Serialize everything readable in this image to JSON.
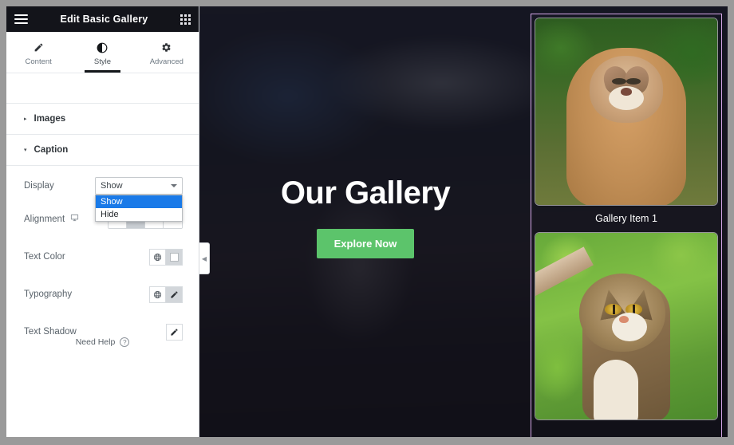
{
  "panel": {
    "title": "Edit Basic Gallery",
    "menu_icon": "hamburger-icon",
    "apps_icon": "grid-apps-icon",
    "tabs": [
      {
        "label": "Content",
        "icon": "pencil-icon",
        "active": false
      },
      {
        "label": "Style",
        "icon": "contrast-icon",
        "active": true
      },
      {
        "label": "Advanced",
        "icon": "gear-icon",
        "active": false
      }
    ],
    "sections": [
      {
        "title": "Images",
        "expanded": false,
        "arrow": "▸"
      },
      {
        "title": "Caption",
        "expanded": true,
        "arrow": "▾"
      }
    ],
    "controls": {
      "display": {
        "label": "Display",
        "value": "Show",
        "open": true,
        "options": [
          {
            "label": "Show",
            "selected": true
          },
          {
            "label": "Hide",
            "selected": false
          }
        ]
      },
      "alignment": {
        "label": "Alignment",
        "device_icon": "desktop-monitor-icon",
        "options": [
          "left",
          "center",
          "right",
          "justify"
        ],
        "selected": "center"
      },
      "text_color": {
        "label": "Text Color",
        "global_icon": "globe-icon",
        "swatch": "#ffffff"
      },
      "typography": {
        "label": "Typography",
        "global_icon": "globe-icon",
        "edit_icon": "pencil-edit-icon"
      },
      "text_shadow": {
        "label": "Text Shadow",
        "edit_icon": "pencil-edit-icon"
      }
    },
    "need_help": {
      "label": "Need Help",
      "icon": "question-circle-icon"
    },
    "collapse_handle": {
      "icon": "chevron-left-icon",
      "glyph": "◀"
    }
  },
  "canvas": {
    "hero": {
      "title": "Our Gallery",
      "button_label": "Explore Now",
      "button_color": "#5cc46b"
    },
    "gallery": {
      "selection_color": "#d5a7e8",
      "items": [
        {
          "caption": "Gallery Item 1",
          "image": "cougar-photo"
        },
        {
          "caption": "",
          "image": "tabby-cat-photo"
        }
      ]
    }
  }
}
